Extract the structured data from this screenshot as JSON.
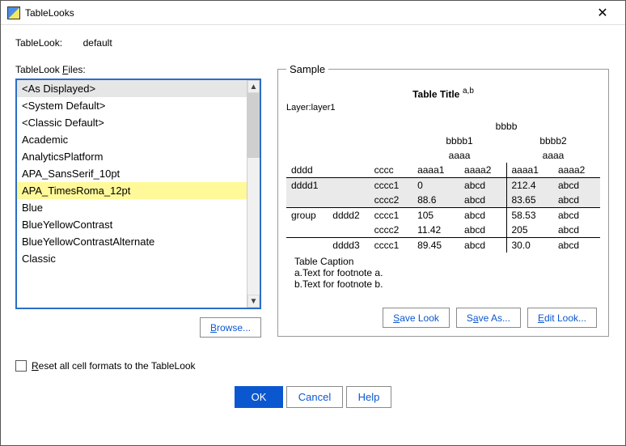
{
  "window": {
    "title": "TableLooks"
  },
  "current": {
    "label": "TableLook:",
    "value": "default"
  },
  "filesLabel": {
    "pre": "TableLook ",
    "u": "F",
    "post": "iles:"
  },
  "files": {
    "items": [
      "<As Displayed>",
      "<System Default>",
      "<Classic Default>",
      "Academic",
      "AnalyticsPlatform",
      "APA_SansSerif_10pt",
      "APA_TimesRoma_12pt",
      "Blue",
      "BlueYellowContrast",
      "BlueYellowContrastAlternate",
      "Classic"
    ],
    "selected_index": 6
  },
  "browse": {
    "u": "B",
    "rest": "rowse..."
  },
  "reset": {
    "u": "R",
    "rest": "eset all cell formats to the TableLook"
  },
  "sample": {
    "legend": "Sample",
    "title": "Table Title",
    "title_sup": "a,b",
    "layer": "Layer:layer1",
    "headers": {
      "top": "bbbb",
      "g1": "bbbb1",
      "g2": "bbbb2",
      "sub": "aaaa",
      "c1": "dddd",
      "c2": "cccc",
      "a1": "aaaa1",
      "a2": "aaaa2",
      "a3": "aaaa1",
      "a4": "aaaa2"
    },
    "rows": [
      {
        "d": "dddd1",
        "dd": "",
        "c": "cccc1",
        "v1": "0",
        "v2": "abcd",
        "v3": "212.4",
        "v4": "abcd",
        "shade": true,
        "rt": true
      },
      {
        "d": "",
        "dd": "",
        "c": "cccc2",
        "v1": "88.6",
        "v2": "abcd",
        "v3": "83.65",
        "v4": "abcd",
        "shade": true,
        "rt": false
      },
      {
        "d": "group",
        "dd": "dddd2",
        "c": "cccc1",
        "v1": "105",
        "v2": "abcd",
        "v3": "58.53",
        "v4": "abcd",
        "shade": false,
        "rt": true
      },
      {
        "d": "",
        "dd": "",
        "c": "cccc2",
        "v1": "11.42",
        "v2": "abcd",
        "v3": "205",
        "v4": "abcd",
        "shade": false,
        "rt": false
      },
      {
        "d": "",
        "dd": "dddd3",
        "c": "cccc1",
        "v1": "89.45",
        "v2": "abcd",
        "v3": "30.0",
        "v4": "abcd",
        "shade": false,
        "rt": true
      }
    ],
    "caption": "Table Caption",
    "fn1": "a.Text for footnote a.",
    "fn2": "b.Text for footnote b."
  },
  "buttons": {
    "saveLook": {
      "u": "S",
      "rest": "ave Look"
    },
    "saveAs": {
      "pre": "S",
      "u": "a",
      "rest": "ve As..."
    },
    "editLook": {
      "u": "E",
      "rest": "dit Look..."
    },
    "ok": "OK",
    "cancel": "Cancel",
    "help": "Help"
  }
}
